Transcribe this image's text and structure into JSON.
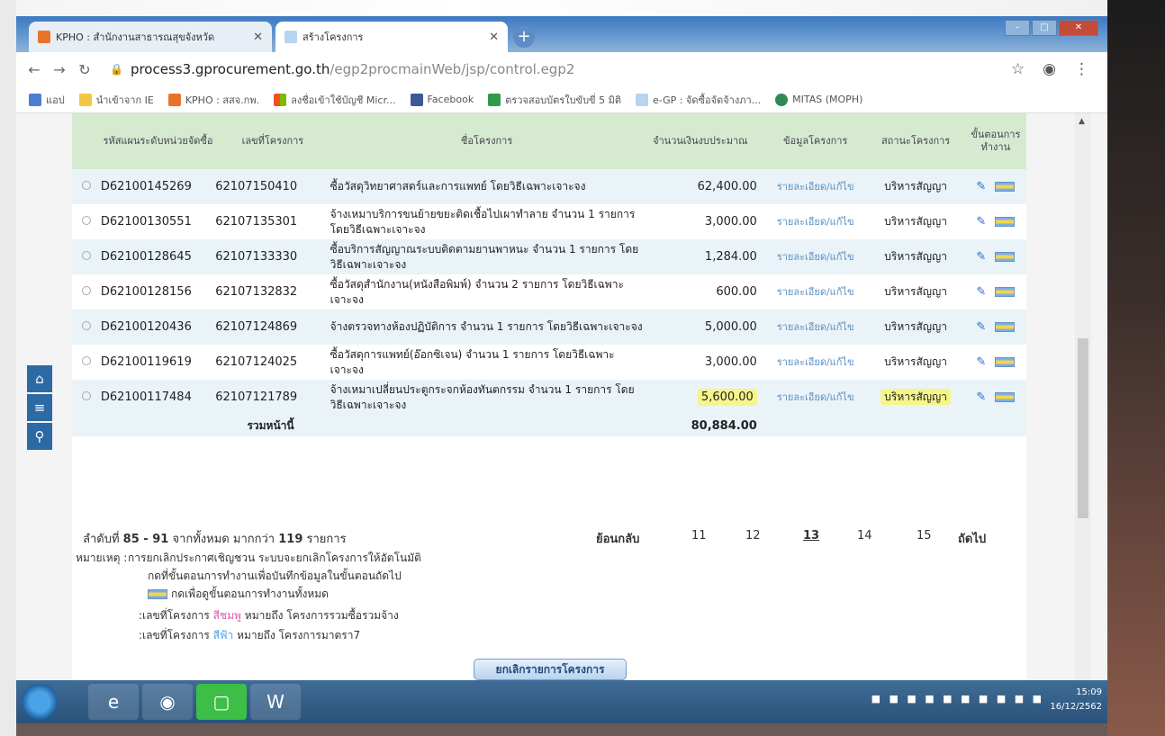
{
  "browser": {
    "tabs": [
      {
        "label": "KPHO : สำนักงานสาธารณสุขจังหวัด"
      },
      {
        "label": "สร้างโครงการ"
      }
    ],
    "url_host": "process3.gprocurement.go.th",
    "url_path": "/egp2procmainWeb/jsp/control.egp2",
    "bookmarks": [
      "แอป",
      "นำเข้าจาก IE",
      "KPHO : สสจ.กพ.",
      "ลงชื่อเข้าใช้บัญชี Micr...",
      "Facebook",
      "ตรวจสอบบัตรใบขับขี่ 5 มิติ",
      "e-GP : จัดซื้อจัดจ้างภา...",
      "MITAS (MOPH)"
    ]
  },
  "table": {
    "headers": [
      "รหัสแผนระดับหน่วยจัดซื้อ",
      "เลขที่โครงการ",
      "ชื่อโครงการ",
      "จำนวนเงินงบประมาณ",
      "ข้อมูลโครงการ",
      "สถานะโครงการ",
      "ขั้นตอนการทำงาน"
    ],
    "rows": [
      {
        "code": "D62100145269",
        "no": "62107150410",
        "name": "ซื้อวัสดุวิทยาศาสตร์และการแพทย์ โดยวิธีเฉพาะเจาะจง",
        "amount": "62,400.00",
        "info": "รายละเอียด/แก้ไข",
        "status": "บริหารสัญญา"
      },
      {
        "code": "D62100130551",
        "no": "62107135301",
        "name": "จ้างเหมาบริการขนย้ายขยะติดเชื้อไปเผาทำลาย จำนวน 1 รายการ โดยวิธีเฉพาะเจาะจง",
        "amount": "3,000.00",
        "info": "รายละเอียด/แก้ไข",
        "status": "บริหารสัญญา"
      },
      {
        "code": "D62100128645",
        "no": "62107133330",
        "name": "ซื้อบริการสัญญาณระบบติดตามยานพาหนะ จำนวน 1 รายการ โดยวิธีเฉพาะเจาะจง",
        "amount": "1,284.00",
        "info": "รายละเอียด/แก้ไข",
        "status": "บริหารสัญญา"
      },
      {
        "code": "D62100128156",
        "no": "62107132832",
        "name": "ซื้อวัสดุสำนักงาน(หนังสือพิมพ์) จำนวน 2 รายการ โดยวิธีเฉพาะเจาะจง",
        "amount": "600.00",
        "info": "รายละเอียด/แก้ไข",
        "status": "บริหารสัญญา"
      },
      {
        "code": "D62100120436",
        "no": "62107124869",
        "name": "จ้างตรวจทางห้องปฏิบัติการ จำนวน 1 รายการ โดยวิธีเฉพาะเจาะจง",
        "amount": "5,000.00",
        "info": "รายละเอียด/แก้ไข",
        "status": "บริหารสัญญา"
      },
      {
        "code": "D62100119619",
        "no": "62107124025",
        "name": "ซื้อวัสดุการแพทย์(อ๊อกซิเจน) จำนวน 1 รายการ โดยวิธีเฉพาะเจาะจง",
        "amount": "3,000.00",
        "info": "รายละเอียด/แก้ไข",
        "status": "บริหารสัญญา"
      },
      {
        "code": "D62100117484",
        "no": "62107121789",
        "name": "จ้างเหมาเปลี่ยนประตูกระจกห้องทันตกรรม จำนวน 1 รายการ โดยวิธีเฉพาะเจาะจง",
        "amount": "5,600.00",
        "info": "รายละเอียด/แก้ไข",
        "status": "บริหารสัญญา"
      }
    ],
    "total_label": "รวมหน้านี้",
    "total_amount": "80,884.00"
  },
  "pager": {
    "summary_prefix": "ลำดับที่",
    "range": "85 - 91",
    "summary_mid": "จากทั้งหมด มากกว่า",
    "total": "119",
    "summary_suffix": "รายการ",
    "back": "ย้อนกลับ",
    "pages": [
      "11",
      "12",
      "13",
      "14",
      "15"
    ],
    "next": "ถัดไป"
  },
  "notes": {
    "label": "หมายเหตุ :",
    "line1": "การยกเลิกประกาศเชิญชวน ระบบจะยกเลิกโครงการให้อัตโนมัติ",
    "line2": "กดที่ขั้นตอนการทำงานเพื่อบันทึกข้อมูลในขั้นตอนถัดไป",
    "line3": "กดเพื่อดูขั้นตอนการทำงานทั้งหมด",
    "line4_a": ":เลขที่โครงการ",
    "line4_color": "สีชมพู",
    "line4_b": "หมายถึง โครงการรวมซื้อรวมจ้าง",
    "line5_a": ":เลขที่โครงการ",
    "line5_color": "สีฟ้า",
    "line5_b": "หมายถึง โครงการมาตรา7"
  },
  "cancel_button": "ยกเลิกรายการโครงการ",
  "clock": {
    "time": "15:09",
    "date": "16/12/2562"
  },
  "colors": {
    "header_bg": "#d6ead0",
    "row_alt": "#eaf3f8",
    "highlight": "#f5f58a",
    "link": "#5a8fc0"
  }
}
